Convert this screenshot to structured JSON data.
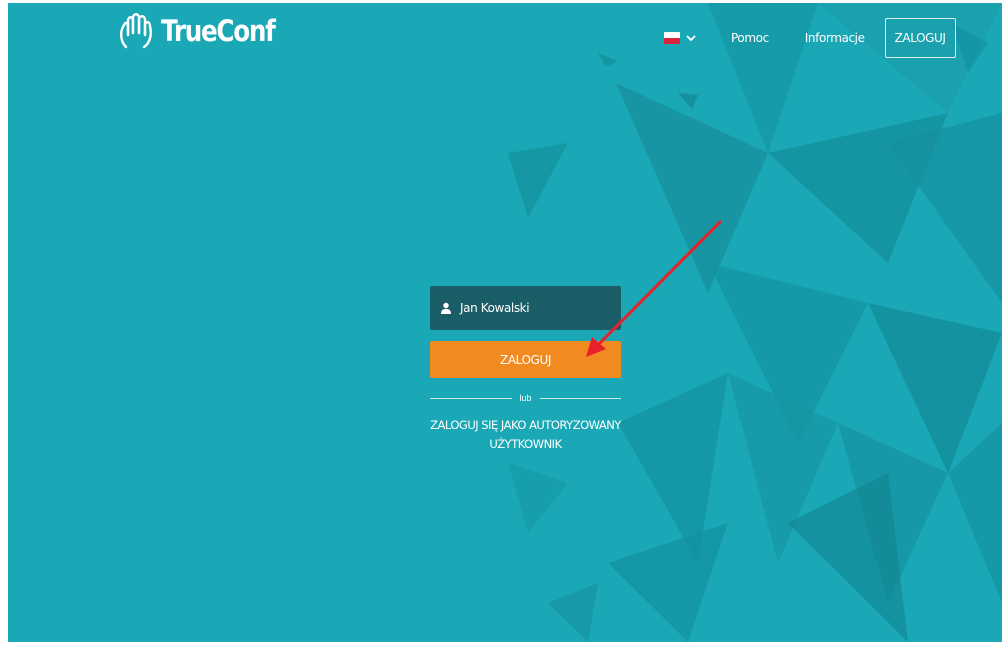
{
  "header": {
    "brand": "TrueConf",
    "language": {
      "flag": "poland-flag-icon",
      "chevron": "chevron-down-icon"
    },
    "nav": {
      "help": "Pomoc",
      "info": "Informacje",
      "login": "ZALOGUJ"
    }
  },
  "login_form": {
    "name_field": {
      "icon": "user-icon",
      "value": "Jan Kowalski"
    },
    "submit_label": "ZALOGUJ",
    "divider_text": "lub",
    "auth_link_line1": "ZALOGUJ SIĘ JAKO AUTORYZOWANY",
    "auth_link_line2": "UŻYTKOWNIK"
  },
  "colors": {
    "background": "#1aa8b6",
    "field_bg": "#1b5d67",
    "accent": "#f18a20",
    "annotation_arrow": "#e8202a"
  }
}
